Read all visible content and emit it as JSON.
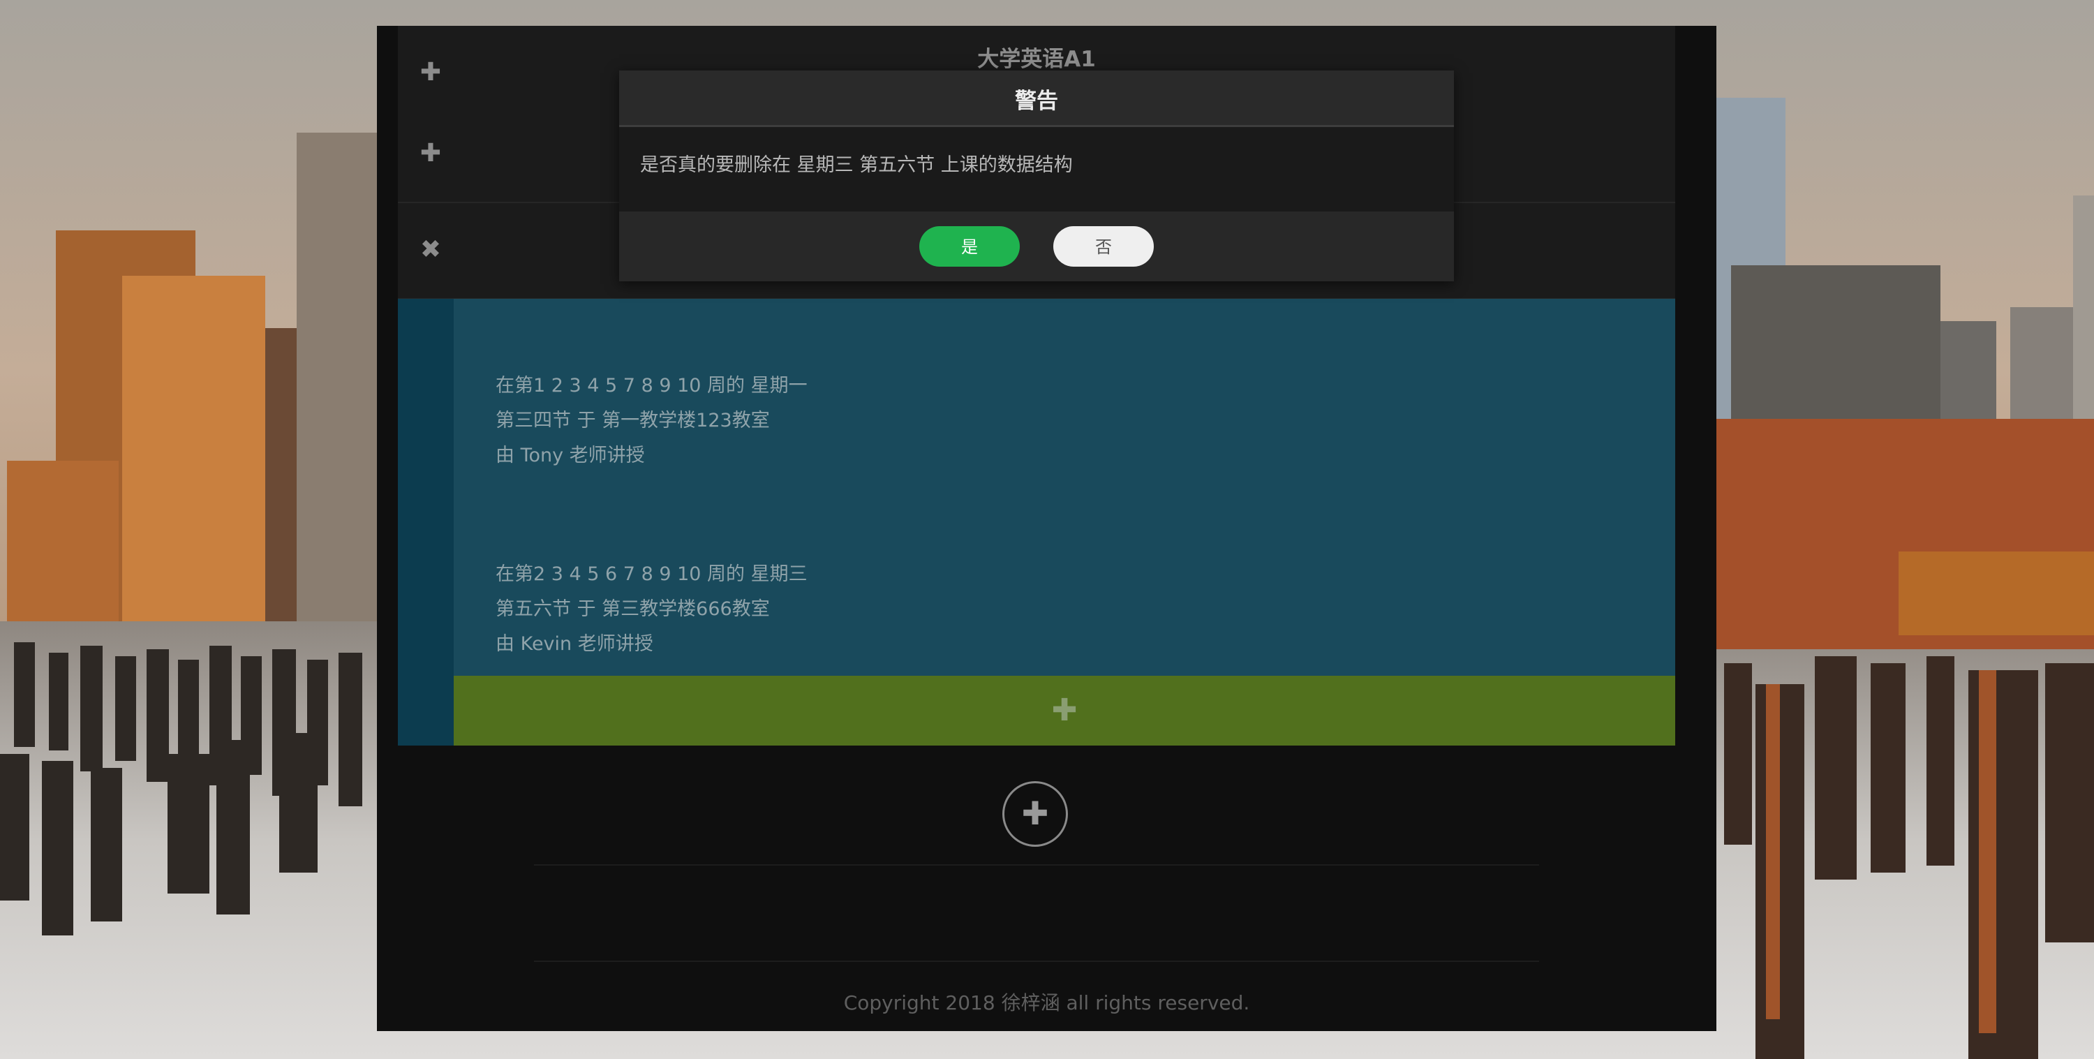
{
  "course_list": {
    "rows": [
      {
        "toggle_icon": "plus-icon",
        "toggle_symbol": "✚",
        "title": "大学英语A1"
      },
      {
        "toggle_icon": "plus-icon",
        "toggle_symbol": "✚",
        "title": ""
      },
      {
        "toggle_icon": "close-icon",
        "toggle_symbol": "✖",
        "title": ""
      }
    ],
    "sessions": [
      {
        "line1": "在第1 2 3 4 5 7 8 9 10 周的 星期一",
        "line2": "第三四节 于 第一教学楼123教室",
        "line3": "由 Tony 老师讲授"
      },
      {
        "line1": "在第2 3 4 5 6 7 8 9 10 周的 星期三",
        "line2": "第五六节 于 第三教学楼666教室",
        "line3": "由 Kevin 老师讲授"
      }
    ],
    "add_session_symbol": "✚",
    "add_course_symbol": "✚"
  },
  "footer": {
    "copyright": "Copyright 2018 徐梓涵 all rights reserved."
  },
  "dialog": {
    "title": "警告",
    "message": "是否真的要删除在 星期三 第五六节 上课的数据结构",
    "yes_label": "是",
    "no_label": "否"
  },
  "colors": {
    "panel": "#0f0f0f",
    "detail": "#194a5c",
    "add_session": "#51701d",
    "yes_button": "#1fb34f",
    "no_button": "#efefef"
  }
}
